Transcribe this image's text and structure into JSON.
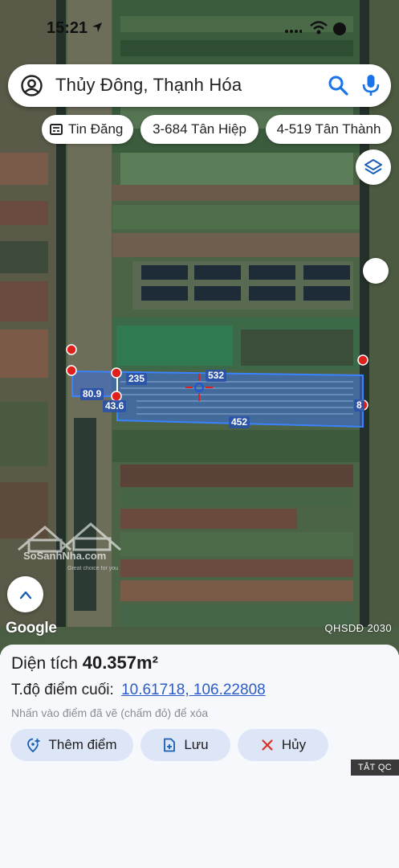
{
  "status_bar": {
    "time": "15:21"
  },
  "search": {
    "query": "Thủy Đông, Thạnh Hóa"
  },
  "chips": [
    {
      "label": "Tin Đăng",
      "icon": "news-icon"
    },
    {
      "label": "3-684 Tân Hiệp"
    },
    {
      "label": "4-519 Tân Thành"
    }
  ],
  "parcel": {
    "edge_labels": {
      "top_right": "532",
      "top_left": "235",
      "left_upper": "80.9",
      "left_lower": "43.6",
      "bottom": "452",
      "right": "8"
    },
    "fill_color": "#3a6fe0"
  },
  "watermark": {
    "brand": "SoSanhNha.com",
    "tagline": "Great choice for you"
  },
  "map_footer": {
    "logo": "Google",
    "plan_label": "QHSDĐ 2030"
  },
  "sheet": {
    "area_label": "Diện tích",
    "area_value": "40.357m²",
    "coord_label": "T.độ điểm cuối:",
    "coord_value": "10.61718, 106.22808",
    "hint": "Nhấn vào điểm đã vẽ (chấm đỏ) để xóa",
    "buttons": {
      "add": "Thêm điểm",
      "save": "Lưu",
      "cancel": "Hủy"
    },
    "ads_toggle": "TẮT QC"
  },
  "colors": {
    "accent": "#2c5cc4",
    "button_bg": "#dde6f6",
    "marker_red": "#e0201c",
    "cancel_red": "#d93025"
  }
}
